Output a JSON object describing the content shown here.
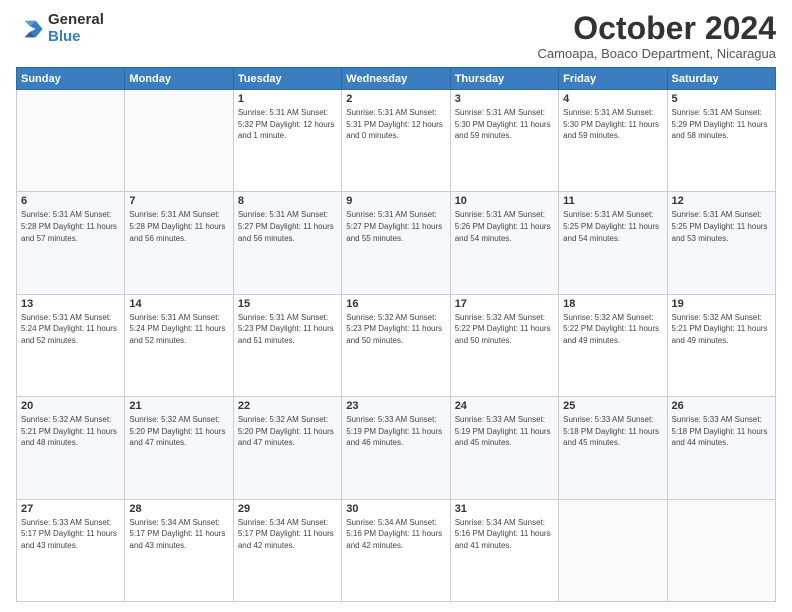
{
  "header": {
    "logo_general": "General",
    "logo_blue": "Blue",
    "month_title": "October 2024",
    "subtitle": "Camoapa, Boaco Department, Nicaragua"
  },
  "weekdays": [
    "Sunday",
    "Monday",
    "Tuesday",
    "Wednesday",
    "Thursday",
    "Friday",
    "Saturday"
  ],
  "weeks": [
    [
      {
        "day": "",
        "info": ""
      },
      {
        "day": "",
        "info": ""
      },
      {
        "day": "1",
        "info": "Sunrise: 5:31 AM\nSunset: 5:32 PM\nDaylight: 12 hours\nand 1 minute."
      },
      {
        "day": "2",
        "info": "Sunrise: 5:31 AM\nSunset: 5:31 PM\nDaylight: 12 hours\nand 0 minutes."
      },
      {
        "day": "3",
        "info": "Sunrise: 5:31 AM\nSunset: 5:30 PM\nDaylight: 11 hours\nand 59 minutes."
      },
      {
        "day": "4",
        "info": "Sunrise: 5:31 AM\nSunset: 5:30 PM\nDaylight: 11 hours\nand 59 minutes."
      },
      {
        "day": "5",
        "info": "Sunrise: 5:31 AM\nSunset: 5:29 PM\nDaylight: 11 hours\nand 58 minutes."
      }
    ],
    [
      {
        "day": "6",
        "info": "Sunrise: 5:31 AM\nSunset: 5:28 PM\nDaylight: 11 hours\nand 57 minutes."
      },
      {
        "day": "7",
        "info": "Sunrise: 5:31 AM\nSunset: 5:28 PM\nDaylight: 11 hours\nand 56 minutes."
      },
      {
        "day": "8",
        "info": "Sunrise: 5:31 AM\nSunset: 5:27 PM\nDaylight: 11 hours\nand 56 minutes."
      },
      {
        "day": "9",
        "info": "Sunrise: 5:31 AM\nSunset: 5:27 PM\nDaylight: 11 hours\nand 55 minutes."
      },
      {
        "day": "10",
        "info": "Sunrise: 5:31 AM\nSunset: 5:26 PM\nDaylight: 11 hours\nand 54 minutes."
      },
      {
        "day": "11",
        "info": "Sunrise: 5:31 AM\nSunset: 5:25 PM\nDaylight: 11 hours\nand 54 minutes."
      },
      {
        "day": "12",
        "info": "Sunrise: 5:31 AM\nSunset: 5:25 PM\nDaylight: 11 hours\nand 53 minutes."
      }
    ],
    [
      {
        "day": "13",
        "info": "Sunrise: 5:31 AM\nSunset: 5:24 PM\nDaylight: 11 hours\nand 52 minutes."
      },
      {
        "day": "14",
        "info": "Sunrise: 5:31 AM\nSunset: 5:24 PM\nDaylight: 11 hours\nand 52 minutes."
      },
      {
        "day": "15",
        "info": "Sunrise: 5:31 AM\nSunset: 5:23 PM\nDaylight: 11 hours\nand 51 minutes."
      },
      {
        "day": "16",
        "info": "Sunrise: 5:32 AM\nSunset: 5:23 PM\nDaylight: 11 hours\nand 50 minutes."
      },
      {
        "day": "17",
        "info": "Sunrise: 5:32 AM\nSunset: 5:22 PM\nDaylight: 11 hours\nand 50 minutes."
      },
      {
        "day": "18",
        "info": "Sunrise: 5:32 AM\nSunset: 5:22 PM\nDaylight: 11 hours\nand 49 minutes."
      },
      {
        "day": "19",
        "info": "Sunrise: 5:32 AM\nSunset: 5:21 PM\nDaylight: 11 hours\nand 49 minutes."
      }
    ],
    [
      {
        "day": "20",
        "info": "Sunrise: 5:32 AM\nSunset: 5:21 PM\nDaylight: 11 hours\nand 48 minutes."
      },
      {
        "day": "21",
        "info": "Sunrise: 5:32 AM\nSunset: 5:20 PM\nDaylight: 11 hours\nand 47 minutes."
      },
      {
        "day": "22",
        "info": "Sunrise: 5:32 AM\nSunset: 5:20 PM\nDaylight: 11 hours\nand 47 minutes."
      },
      {
        "day": "23",
        "info": "Sunrise: 5:33 AM\nSunset: 5:19 PM\nDaylight: 11 hours\nand 46 minutes."
      },
      {
        "day": "24",
        "info": "Sunrise: 5:33 AM\nSunset: 5:19 PM\nDaylight: 11 hours\nand 45 minutes."
      },
      {
        "day": "25",
        "info": "Sunrise: 5:33 AM\nSunset: 5:18 PM\nDaylight: 11 hours\nand 45 minutes."
      },
      {
        "day": "26",
        "info": "Sunrise: 5:33 AM\nSunset: 5:18 PM\nDaylight: 11 hours\nand 44 minutes."
      }
    ],
    [
      {
        "day": "27",
        "info": "Sunrise: 5:33 AM\nSunset: 5:17 PM\nDaylight: 11 hours\nand 43 minutes."
      },
      {
        "day": "28",
        "info": "Sunrise: 5:34 AM\nSunset: 5:17 PM\nDaylight: 11 hours\nand 43 minutes."
      },
      {
        "day": "29",
        "info": "Sunrise: 5:34 AM\nSunset: 5:17 PM\nDaylight: 11 hours\nand 42 minutes."
      },
      {
        "day": "30",
        "info": "Sunrise: 5:34 AM\nSunset: 5:16 PM\nDaylight: 11 hours\nand 42 minutes."
      },
      {
        "day": "31",
        "info": "Sunrise: 5:34 AM\nSunset: 5:16 PM\nDaylight: 11 hours\nand 41 minutes."
      },
      {
        "day": "",
        "info": ""
      },
      {
        "day": "",
        "info": ""
      }
    ]
  ]
}
